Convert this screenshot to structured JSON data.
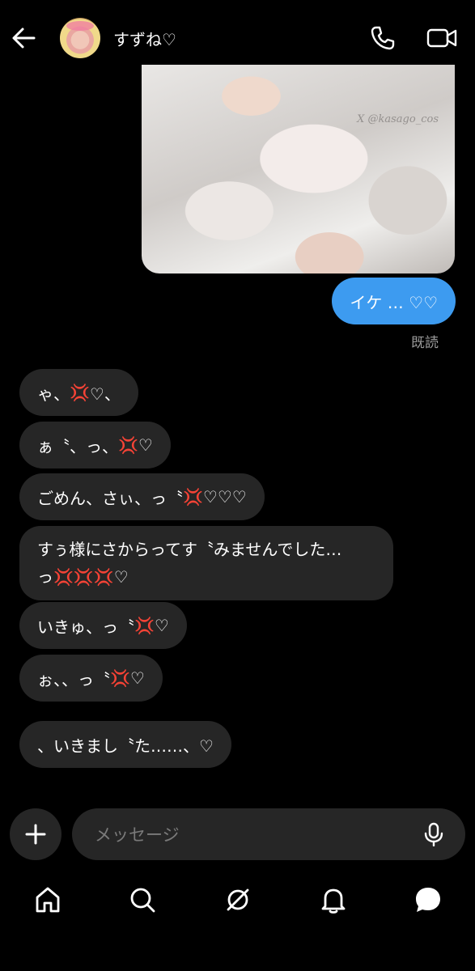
{
  "header": {
    "contact_name": "すずね♡",
    "icons": [
      "back-arrow-icon",
      "phone-icon",
      "video-camera-icon"
    ]
  },
  "image_message": {
    "watermark": "X @kasago_cos"
  },
  "sent_message": {
    "text": "イケ … ♡♡",
    "status": "既読",
    "color": "#3d9bf0"
  },
  "received_messages": [
    {
      "parts": [
        "ゃ、",
        "💢",
        "♡、"
      ]
    },
    {
      "parts": [
        "ぁ〝、っ、",
        "💢",
        "♡"
      ]
    },
    {
      "parts": [
        "ごめん、さぃ、っ〝",
        "💢",
        "♡♡♡"
      ]
    },
    {
      "parts": [
        "すぅ様にさからってす〝みませんでした…",
        "\n",
        "っ",
        "💢💢💢",
        "♡"
      ]
    },
    {
      "parts": [
        "いきゅ、っ〝",
        "💢",
        "♡"
      ]
    },
    {
      "parts": [
        "ぉ、、っ〝",
        "💢",
        "♡"
      ]
    },
    {
      "parts": [
        "、いきまし〝た……、♡"
      ]
    }
  ],
  "composer": {
    "placeholder": "メッセージ",
    "icons": [
      "plus-icon",
      "microphone-icon"
    ]
  },
  "bottom_nav": {
    "icons": [
      "home-icon",
      "search-icon",
      "explore-icon",
      "notifications-bell-icon",
      "messages-icon"
    ]
  },
  "colors": {
    "background": "#000000",
    "bubble_received": "#262626",
    "bubble_sent": "#3d9bf0",
    "anger_mark": "#e8413c"
  }
}
